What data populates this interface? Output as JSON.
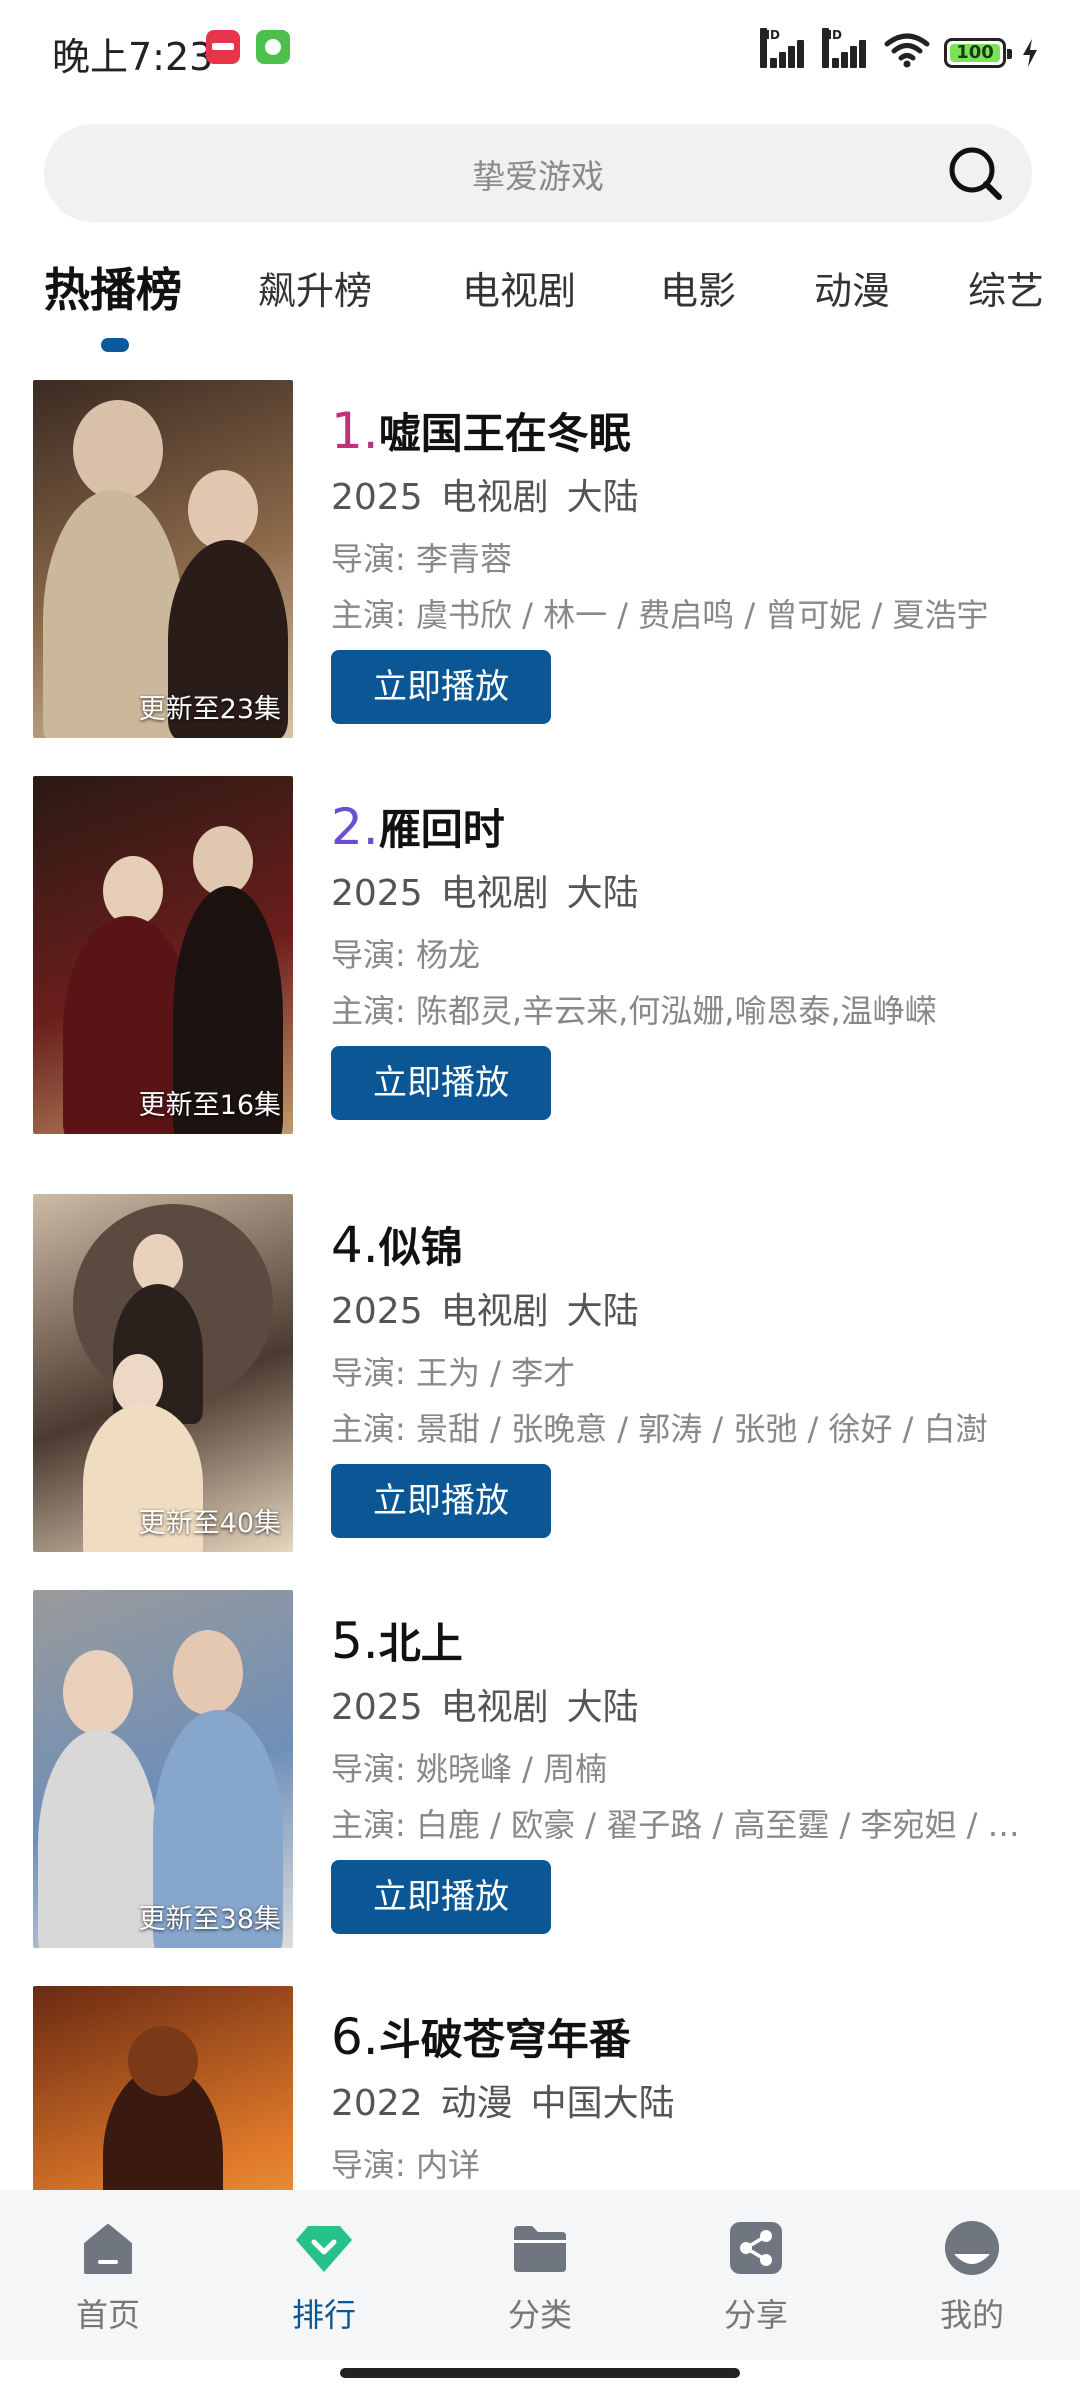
{
  "status_bar": {
    "time": "晚上7:23",
    "signal1_label": "HD",
    "signal2_label": "HD",
    "battery": "100"
  },
  "search": {
    "placeholder": "挚爱游戏"
  },
  "tabs": [
    {
      "label": "热播榜",
      "active": true
    },
    {
      "label": "飙升榜",
      "active": false
    },
    {
      "label": "电视剧",
      "active": false
    },
    {
      "label": "电影",
      "active": false
    },
    {
      "label": "动漫",
      "active": false
    },
    {
      "label": "综艺",
      "active": false
    }
  ],
  "items": [
    {
      "rank": "1.",
      "rank_color": "#c2307a",
      "title": "嘘国王在冬眠",
      "year": "2025",
      "type": "电视剧",
      "region": "大陆",
      "director": "导演:  李青蓉",
      "cast": "主演:  虞书欣 / 林一 / 费启鸣 / 曾可妮 / 夏浩宇",
      "update": "更新至23集",
      "play_label": "立即播放",
      "poster_colors": [
        "#3a2a22",
        "#8c6a4a",
        "#d8c3a5"
      ]
    },
    {
      "rank": "2.",
      "rank_color": "#6a4fd6",
      "title": "雁回时",
      "year": "2025",
      "type": "电视剧",
      "region": "大陆",
      "director": "导演:  杨龙",
      "cast": "主演:  陈都灵,辛云来,何泓姗,喻恩泰,温峥嵘",
      "update": "更新至16集",
      "play_label": "立即播放",
      "poster_colors": [
        "#2a1a14",
        "#6a1e1c",
        "#c09a6a"
      ]
    },
    {
      "rank": "4.",
      "rank_color": "#111111",
      "title": "似锦",
      "year": "2025",
      "type": "电视剧",
      "region": "大陆",
      "director": "导演:  王为 / 李才",
      "cast": "主演:  景甜 / 张晚意 / 郭涛 / 张弛 / 徐好 / 白澍",
      "update": "更新至40集",
      "play_label": "立即播放",
      "poster_colors": [
        "#cdbba6",
        "#4a3a30",
        "#e8d7bf"
      ]
    },
    {
      "rank": "5.",
      "rank_color": "#111111",
      "title": "北上",
      "year": "2025",
      "type": "电视剧",
      "region": "大陆",
      "director": "导演:  姚晓峰 / 周楠",
      "cast": "主演:  白鹿 / 欧豪 / 翟子路 / 高至霆 / 李宛妲 / 王雨",
      "update": "更新至38集",
      "play_label": "立即播放",
      "poster_colors": [
        "#9a9a9a",
        "#6f8fb8",
        "#dddddd"
      ]
    },
    {
      "rank": "6.",
      "rank_color": "#111111",
      "title": "斗破苍穹年番",
      "year": "2022",
      "type": "动漫",
      "region": "中国大陆",
      "director": "导演:  内详",
      "cast": "",
      "update": "",
      "play_label": "立即播放",
      "poster_colors": [
        "#6a2a12",
        "#e07a2a",
        "#f0c060"
      ]
    }
  ],
  "bottom_nav": [
    {
      "label": "首页",
      "icon": "home-icon",
      "active": false
    },
    {
      "label": "排行",
      "icon": "ranking-icon",
      "active": true
    },
    {
      "label": "分类",
      "icon": "folder-icon",
      "active": false
    },
    {
      "label": "分享",
      "icon": "share-icon",
      "active": false
    },
    {
      "label": "我的",
      "icon": "profile-icon",
      "active": false
    }
  ],
  "colors": {
    "accent": "#0b5694",
    "nav_active_icon": "#27c28a",
    "nav_inactive_icon": "#6f7680"
  }
}
